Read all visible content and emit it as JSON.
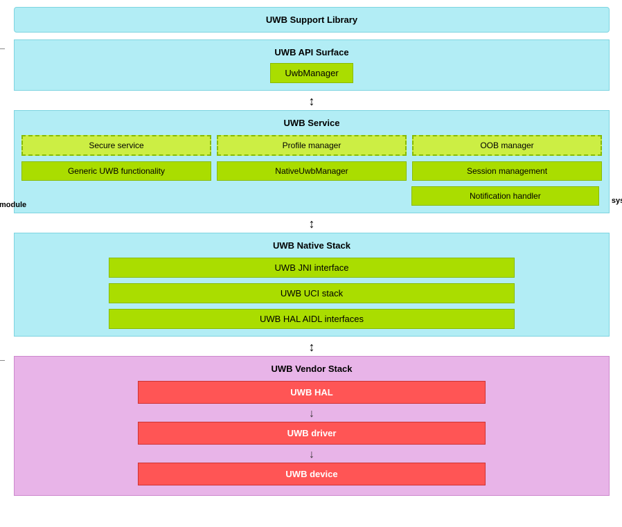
{
  "diagram": {
    "aosp_label": "AOSP module",
    "system_label": "system_server\nprocess",
    "support_library": {
      "title": "UWB Support Library"
    },
    "api_surface": {
      "title": "UWB API Surface",
      "uwb_manager": "UwbManager"
    },
    "service": {
      "title": "UWB Service",
      "row1": [
        {
          "label": "Secure service",
          "style": "dashed"
        },
        {
          "label": "Profile manager",
          "style": "dashed"
        },
        {
          "label": "OOB manager",
          "style": "dashed"
        }
      ],
      "row2": [
        {
          "label": "Generic UWB functionality",
          "style": "solid"
        },
        {
          "label": "NativeUwbManager",
          "style": "solid"
        },
        {
          "label": "Session management",
          "style": "solid"
        }
      ],
      "row3": [
        {
          "label": "Notification handler",
          "style": "solid"
        }
      ]
    },
    "native_stack": {
      "title": "UWB Native Stack",
      "items": [
        "UWB JNI interface",
        "UWB UCI stack",
        "UWB HAL AIDL interfaces"
      ]
    },
    "vendor_stack": {
      "title": "UWB Vendor Stack",
      "items": [
        "UWB HAL",
        "UWB driver",
        "UWB device"
      ]
    }
  }
}
